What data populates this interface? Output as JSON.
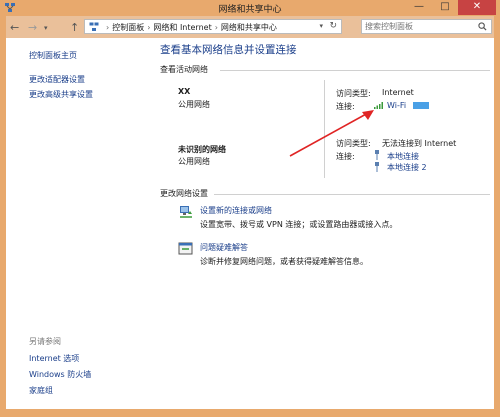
{
  "window": {
    "title": "网络和共享中心",
    "minimize": "—",
    "maximize": "□",
    "close": "✕"
  },
  "address": {
    "crumbs": [
      "控制面板",
      "网络和 Internet",
      "网络和共享中心"
    ],
    "search_placeholder": "搜索控制面板"
  },
  "sidebar": {
    "home": "控制面板主页",
    "links": [
      "更改适配器设置",
      "更改高级共享设置"
    ],
    "see_also_label": "另请参阅",
    "see_also": [
      "Internet 选项",
      "Windows 防火墙",
      "家庭组"
    ]
  },
  "main": {
    "title": "查看基本网络信息并设置连接",
    "active_header": "查看活动网络",
    "networks": [
      {
        "name": "XX",
        "type": "公用网络",
        "access_label": "访问类型:",
        "access_value": "Internet",
        "conn_label": "连接:",
        "conn_value": "Wi-Fi"
      },
      {
        "name": "未识别的网络",
        "type": "公用网络",
        "access_label": "访问类型:",
        "access_value": "无法连接到 Internet",
        "conn_label": "连接:",
        "conn_values": [
          "本地连接",
          "本地连接 2"
        ]
      }
    ],
    "change_header": "更改网络设置",
    "tasks": [
      {
        "title": "设置新的连接或网络",
        "desc": "设置宽带、拨号或 VPN 连接；或设置路由器或接入点。"
      },
      {
        "title": "问题疑难解答",
        "desc": "诊断并修复网络问题，或者获得疑难解答信息。"
      }
    ]
  },
  "colors": {
    "link": "#1a3e8a",
    "frame": "#e8a96d",
    "close": "#c74343",
    "arrow": "#e02424"
  }
}
